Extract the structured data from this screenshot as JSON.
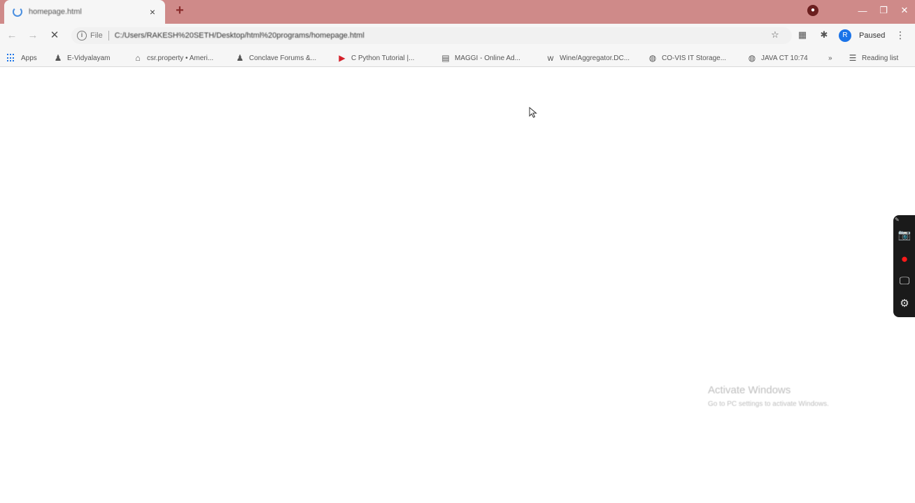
{
  "tab": {
    "title": "homepage.html",
    "close_glyph": "×",
    "new_tab_glyph": "+"
  },
  "window": {
    "minimize_glyph": "—",
    "maximize_glyph": "❐",
    "close_glyph": "✕"
  },
  "toolbar": {
    "back_glyph": "←",
    "forward_glyph": "→",
    "reload_glyph": "✕",
    "scheme": "File",
    "url": "C:/Users/RAKESH%20SETH/Desktop/html%20programs/homepage.html",
    "profile_initial": "R",
    "profile_name": "Paused",
    "menu_glyph": "⋮"
  },
  "bookmarks": {
    "apps_label": "Apps",
    "items": [
      {
        "label": "E-Vidyalayam",
        "icon": "person-icon"
      },
      {
        "label": "csr.property • Ameri...",
        "icon": "building-icon"
      },
      {
        "label": "Conclave Forums &...",
        "icon": "person-icon"
      },
      {
        "label": "C Python Tutorial |...",
        "icon": "video-icon"
      },
      {
        "label": "MAGGI - Online Ad...",
        "icon": "calendar-icon"
      },
      {
        "label": "Wine/Aggregator.DC...",
        "icon": "wine-icon"
      },
      {
        "label": "CO-VIS IT Storage...",
        "icon": "globe-icon"
      },
      {
        "label": "JAVA CT 10:74",
        "icon": "globe-icon"
      }
    ],
    "overflow_glyph": "»",
    "other_label": "Reading list"
  },
  "recorder_widget": {
    "items": [
      {
        "name": "camera-icon",
        "glyph": "📷"
      },
      {
        "name": "record-icon",
        "glyph": "●"
      },
      {
        "name": "screen-icon",
        "glyph": "🖵"
      },
      {
        "name": "settings-icon",
        "glyph": "⚙"
      }
    ]
  },
  "watermark": {
    "title": "Activate Windows",
    "subtitle": "Go to PC settings to activate Windows."
  },
  "colors": {
    "tabstrip": "#cf8a89",
    "chrome_bg": "#f6f6f6",
    "accent_blue": "#1a73e8",
    "record_red": "#ff1a1a"
  }
}
